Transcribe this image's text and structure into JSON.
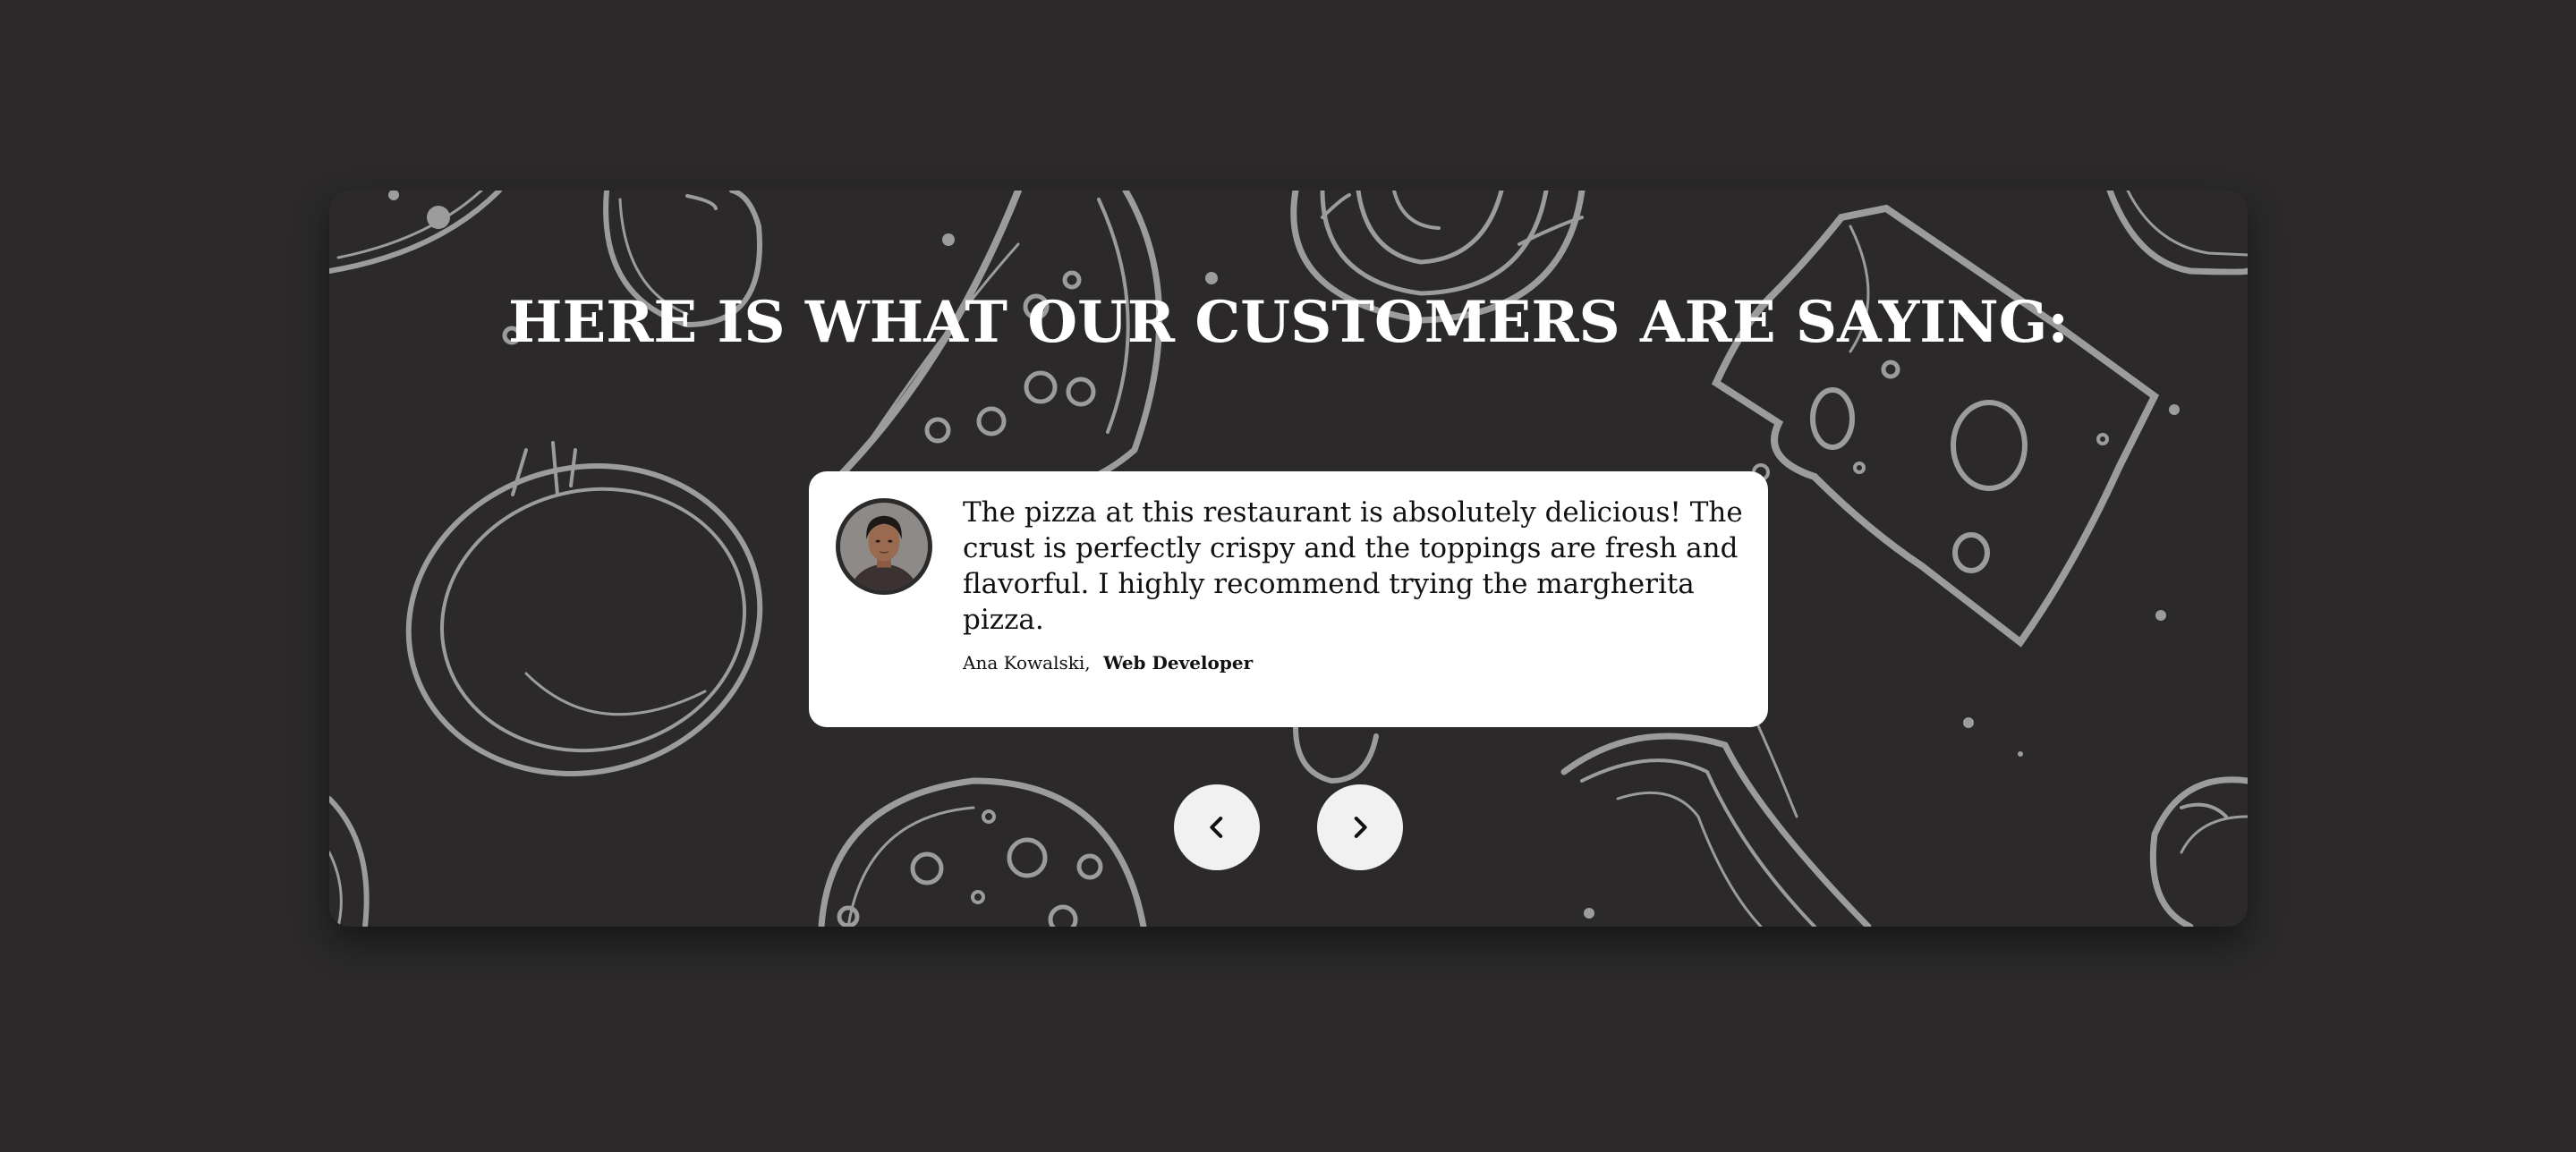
{
  "section": {
    "heading": "HERE IS WHAT OUR CUSTOMERS ARE SAYING:"
  },
  "testimonial": {
    "quote": "The pizza at this restaurant is absolutely delicious! The crust is perfectly crispy and the toppings are fresh and flavorful. I highly recommend trying the margherita pizza.",
    "author_name": "Ana Kowalski,",
    "author_role": "Web Developer",
    "avatar_icon": "customer-avatar"
  },
  "navigation": {
    "prev_icon": "chevron-left-icon",
    "next_icon": "chevron-right-icon"
  },
  "colors": {
    "page_background": "#2b292a",
    "panel_background": "#2b292a",
    "doodle_stroke": "#9c9c9c",
    "card_background": "#ffffff",
    "heading_text": "#ffffff",
    "nav_button": "#f1f1f1"
  }
}
